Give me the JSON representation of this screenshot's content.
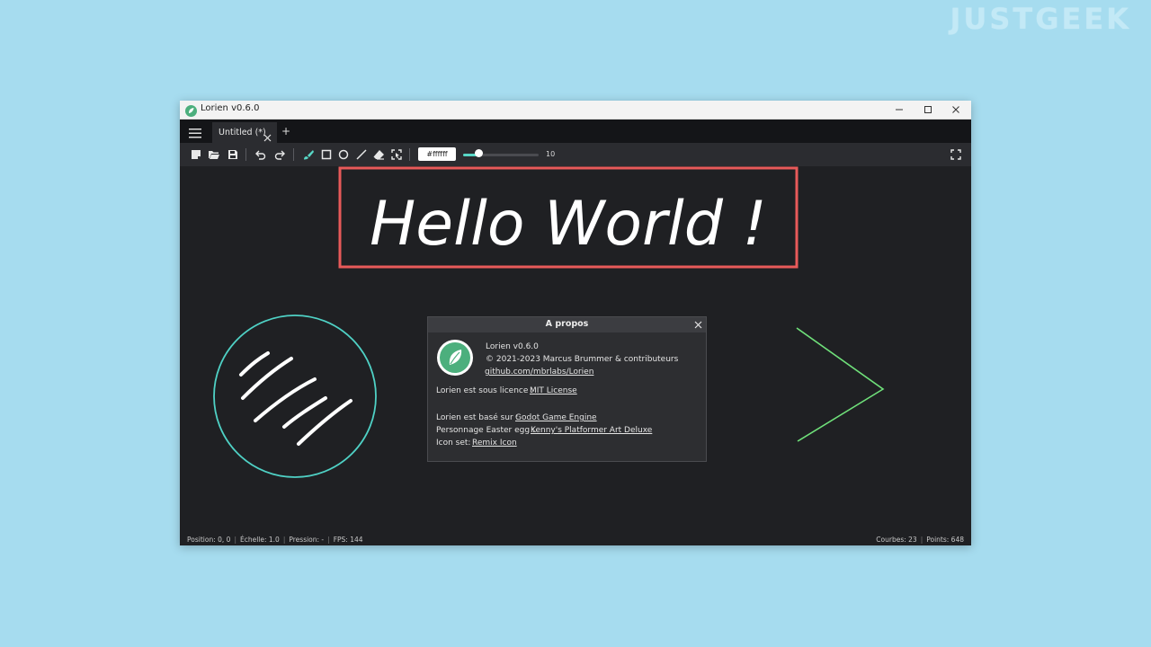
{
  "watermark": "JUSTGEEK",
  "window": {
    "title": "Lorien v0.6.0"
  },
  "tabs": [
    {
      "label": "Untitled (*)"
    }
  ],
  "tab_add_label": "+",
  "toolbar": {
    "color_hex": "#ffffff",
    "brush_size": "10",
    "brush_size_value": 10,
    "brush_size_max": 100
  },
  "canvas": {
    "text": "Hello World !",
    "stroke_colors": {
      "text": "#ffffff",
      "rectangle": "#e85a5a",
      "circle": "#4fd1c5",
      "lines": "#ffffff",
      "chevron": "#6fe07a"
    }
  },
  "dialog": {
    "title": "A propos",
    "app_name": "Lorien v0.6.0",
    "copyright": "© 2021-2023 Marcus Brummer & contributeurs",
    "repo_link": "github.com/mbrlabs/Lorien",
    "license_label": "Lorien est sous licence :",
    "license_link": "MIT License",
    "based_on_label": "Lorien est basé sur :",
    "based_on_link": "Godot Game Engine",
    "easter_egg_label": "Personnage Easter egg :",
    "easter_egg_link": "Kenny's Platformer Art Deluxe",
    "icon_set_label": "Icon set:",
    "icon_set_link": "Remix Icon"
  },
  "statusbar": {
    "position": "Position: 0, 0",
    "scale": "Échelle: 1.0",
    "pressure": "Pression: -",
    "fps": "FPS: 144",
    "curves": "Courbes: 23",
    "points": "Points: 648"
  },
  "colors": {
    "accent": "#58d7c6",
    "background": "#a6dcef",
    "canvas": "#1f2023"
  },
  "icons": {
    "app": "leaf-icon",
    "menu": "hamburger-icon",
    "new": "new-file-icon",
    "open": "folder-open-icon",
    "save": "save-icon",
    "undo": "undo-icon",
    "redo": "redo-icon",
    "brush": "brush-icon",
    "rectangle": "rectangle-tool-icon",
    "circle": "circle-tool-icon",
    "line": "line-tool-icon",
    "eraser": "eraser-icon",
    "selection": "selection-icon",
    "fullscreen": "fullscreen-icon"
  }
}
